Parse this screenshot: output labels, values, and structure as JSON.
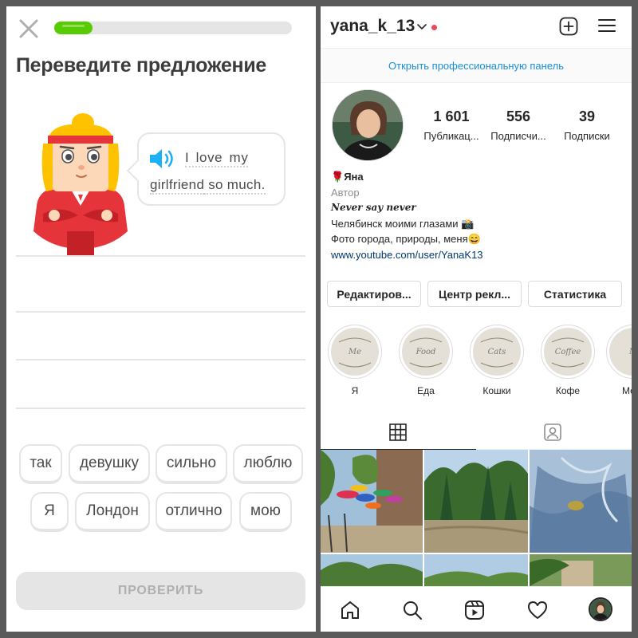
{
  "duolingo": {
    "progress_percent": 16,
    "title": "Переведите предложение",
    "sentence": {
      "line1": "I  love my",
      "line2_word1": "girlfriend",
      "line2_rest": " so much."
    },
    "word_bank": [
      "так",
      "девушку",
      "сильно",
      "люблю",
      "Я",
      "Лондон",
      "отлично",
      "мою"
    ],
    "check_button": "ПРОВЕРИТЬ",
    "colors": {
      "green": "#58cc02",
      "speaker_blue": "#1cb0f6",
      "character_red": "#e5343a"
    },
    "icons": [
      "close-icon",
      "speaker-icon"
    ]
  },
  "instagram": {
    "username": "yana_k_13",
    "pro_panel": "Открыть профессиональную панель",
    "stats": [
      {
        "value": "1 601",
        "label": "Публикац..."
      },
      {
        "value": "556",
        "label": "Подписчи..."
      },
      {
        "value": "39",
        "label": "Подписки"
      }
    ],
    "bio": {
      "name_emoji": "🌹",
      "name": "Яна",
      "category": "Автор",
      "italic_line": "Never say never",
      "line1": "Челябинск моими глазами",
      "line1_emoji": "📸",
      "line2": "Фото города, природы, меня",
      "line2_emoji": "😄",
      "link": "www.youtube.com/user/YanaK13"
    },
    "buttons": [
      "Редактиров...",
      "Центр рекл...",
      "Статистика"
    ],
    "highlights": [
      {
        "cover_text": "Me",
        "label": "Я"
      },
      {
        "cover_text": "Food",
        "label": "Еда"
      },
      {
        "cover_text": "Cats",
        "label": "Кошки"
      },
      {
        "cover_text": "Coffee",
        "label": "Кофе"
      },
      {
        "cover_text": "M",
        "label": "Моск"
      }
    ],
    "colors": {
      "link_blue": "#1a8fd5",
      "notification_red": "#ed4956"
    },
    "icons": [
      "chevron-down-icon",
      "add-post-icon",
      "menu-icon",
      "grid-icon",
      "tagged-icon",
      "home-icon",
      "search-icon",
      "reels-icon",
      "heart-icon"
    ]
  }
}
